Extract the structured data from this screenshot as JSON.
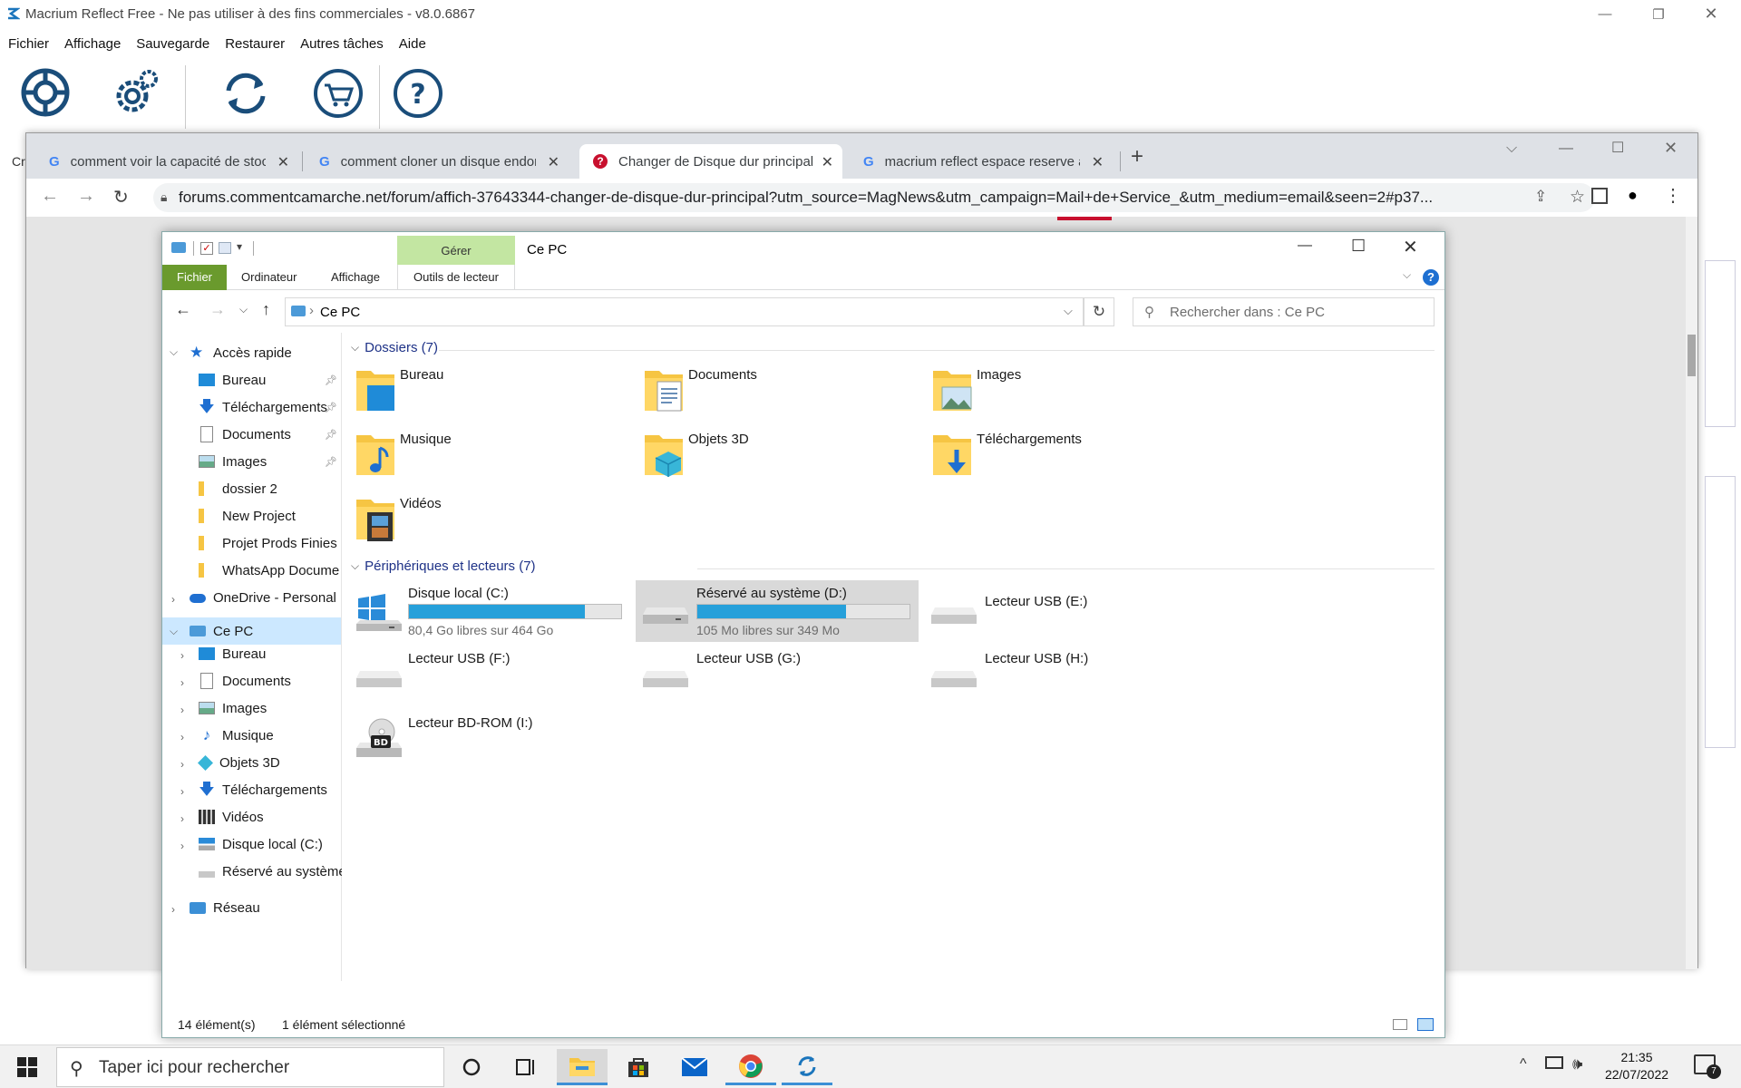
{
  "macrium": {
    "title": "Macrium Reflect Free - Ne pas utiliser à des fins commerciales - v8.0.6867",
    "menu": [
      "Fichier",
      "Affichage",
      "Sauvegarde",
      "Restaurer",
      "Autres tâches",
      "Aide"
    ],
    "toolbar": [
      "rescue-media-icon",
      "settings-gear-icon",
      "migrate-icon",
      "buy-cart-icon",
      "help-icon"
    ],
    "left_edge_label": "Cr"
  },
  "chrome": {
    "tabs": [
      {
        "label": "comment voir la capacité de stockage",
        "icon": "google-icon",
        "active": false
      },
      {
        "label": "comment cloner un disque endommagé",
        "icon": "google-icon",
        "active": false
      },
      {
        "label": "Changer de Disque dur principal",
        "icon": "ccm-icon",
        "active": true
      },
      {
        "label": "macrium reflect espace reserve au",
        "icon": "google-icon",
        "active": false
      }
    ],
    "new_tab": "+",
    "url": "forums.commentcamarche.net/forum/affich-37643344-changer-de-disque-dur-principal?utm_source=MagNews&utm_campaign=Mail+de+Service_&utm_medium=email&seen=2#p37..."
  },
  "explorer": {
    "title": "Ce PC",
    "ribbon": {
      "file": "Fichier",
      "tabs": [
        "Ordinateur",
        "Affichage"
      ],
      "context_group": "Gérer",
      "context_tab": "Outils de lecteur"
    },
    "address": "Ce PC",
    "search_placeholder": "Rechercher dans : Ce PC",
    "nav": {
      "quick_access": "Accès rapide",
      "quick_items": [
        {
          "label": "Bureau",
          "pinned": true
        },
        {
          "label": "Téléchargements",
          "pinned": true
        },
        {
          "label": "Documents",
          "pinned": true
        },
        {
          "label": "Images",
          "pinned": true
        },
        {
          "label": "dossier 2",
          "pinned": false
        },
        {
          "label": "New Project",
          "pinned": false
        },
        {
          "label": "Projet Prods Finies",
          "pinned": false
        },
        {
          "label": "WhatsApp Docume",
          "pinned": false
        }
      ],
      "onedrive": "OneDrive - Personal",
      "this_pc": "Ce PC",
      "pc_items": [
        "Bureau",
        "Documents",
        "Images",
        "Musique",
        "Objets 3D",
        "Téléchargements",
        "Vidéos",
        "Disque local (C:)",
        "Réservé au système"
      ],
      "network": "Réseau"
    },
    "folders_header": "Dossiers (7)",
    "folders": [
      "Bureau",
      "Documents",
      "Images",
      "Musique",
      "Objets 3D",
      "Téléchargements",
      "Vidéos"
    ],
    "drives_header": "Périphériques et lecteurs (7)",
    "drives": [
      {
        "label": "Disque local (C:)",
        "free": "80,4 Go libres sur 464 Go",
        "used_fraction": 0.827,
        "selected": false,
        "icon": "windows-drive-icon"
      },
      {
        "label": "Réservé au système (D:)",
        "free": "105 Mo libres sur 349 Mo",
        "used_fraction": 0.7,
        "selected": true,
        "icon": "hdd-icon"
      },
      {
        "label": "Lecteur USB (E:)",
        "free": "",
        "selected": false,
        "icon": "usb-drive-icon"
      },
      {
        "label": "Lecteur USB (F:)",
        "free": "",
        "selected": false,
        "icon": "usb-drive-icon"
      },
      {
        "label": "Lecteur USB (G:)",
        "free": "",
        "selected": false,
        "icon": "usb-drive-icon"
      },
      {
        "label": "Lecteur USB (H:)",
        "free": "",
        "selected": false,
        "icon": "usb-drive-icon"
      },
      {
        "label": "Lecteur BD-ROM (I:)",
        "free": "",
        "selected": false,
        "icon": "bd-rom-icon"
      }
    ],
    "bd_badge": "BD",
    "status_count": "14 élément(s)",
    "status_selected": "1 élément sélectionné"
  },
  "taskbar": {
    "search_placeholder": "Taper ici pour rechercher",
    "time": "21:35",
    "date": "22/07/2022",
    "notif_count": "7"
  },
  "colors": {
    "accent": "#26a0da",
    "ribbon_file": "#6a9a2d",
    "context_tab": "#c3e6a2",
    "selection": "#cce8ff"
  }
}
